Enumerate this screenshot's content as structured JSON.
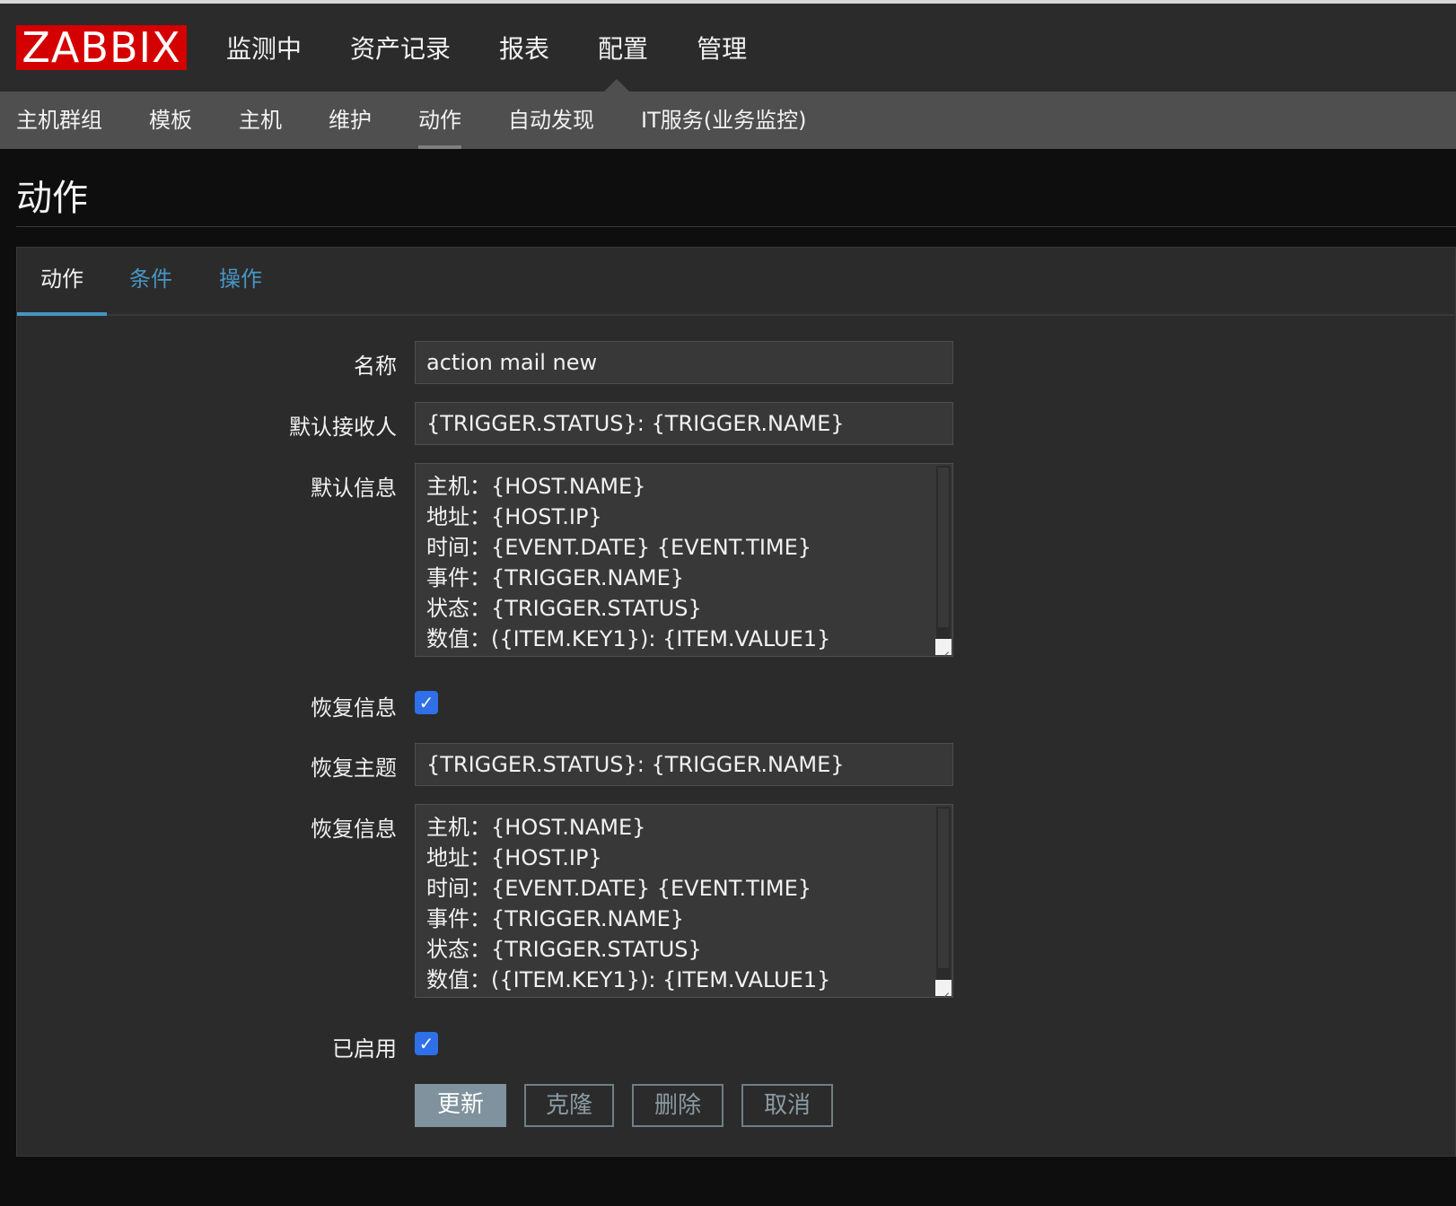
{
  "header": {
    "logo": "ZABBIX",
    "main_nav": [
      "监测中",
      "资产记录",
      "报表",
      "配置",
      "管理"
    ],
    "sub_nav": [
      "主机群组",
      "模板",
      "主机",
      "维护",
      "动作",
      "自动发现",
      "IT服务(业务监控)"
    ]
  },
  "page": {
    "title": "动作"
  },
  "tabs": [
    "动作",
    "条件",
    "操作"
  ],
  "form": {
    "name": {
      "label": "名称",
      "value": "action mail new"
    },
    "default_subject": {
      "label": "默认接收人",
      "value": "{TRIGGER.STATUS}: {TRIGGER.NAME}"
    },
    "default_message": {
      "label": "默认信息",
      "lines": [
        "主机：{HOST.NAME}",
        "地址：{HOST.IP}",
        "时间：{EVENT.DATE} {EVENT.TIME}",
        "事件：{TRIGGER.NAME}",
        "状态：{TRIGGER.STATUS}",
        "数值：({ITEM.KEY1}): {ITEM.VALUE1}"
      ]
    },
    "recovery_enabled": {
      "label": "恢复信息",
      "checked": true
    },
    "recovery_subject": {
      "label": "恢复主题",
      "value": "{TRIGGER.STATUS}: {TRIGGER.NAME}"
    },
    "recovery_message": {
      "label": "恢复信息",
      "lines": [
        "主机：{HOST.NAME}",
        "地址：{HOST.IP}",
        "时间：{EVENT.DATE} {EVENT.TIME}",
        "事件：{TRIGGER.NAME}",
        "状态：{TRIGGER.STATUS}",
        "数值：({ITEM.KEY1}): {ITEM.VALUE1}"
      ]
    },
    "enabled": {
      "label": "已启用",
      "checked": true
    }
  },
  "buttons": {
    "update": "更新",
    "clone": "克隆",
    "delete": "删除",
    "cancel": "取消"
  },
  "colors": {
    "logo_bg": "#d40000",
    "link": "#4796c4",
    "checkbox": "#2f6fe8",
    "primary_button": "#7f929d"
  }
}
